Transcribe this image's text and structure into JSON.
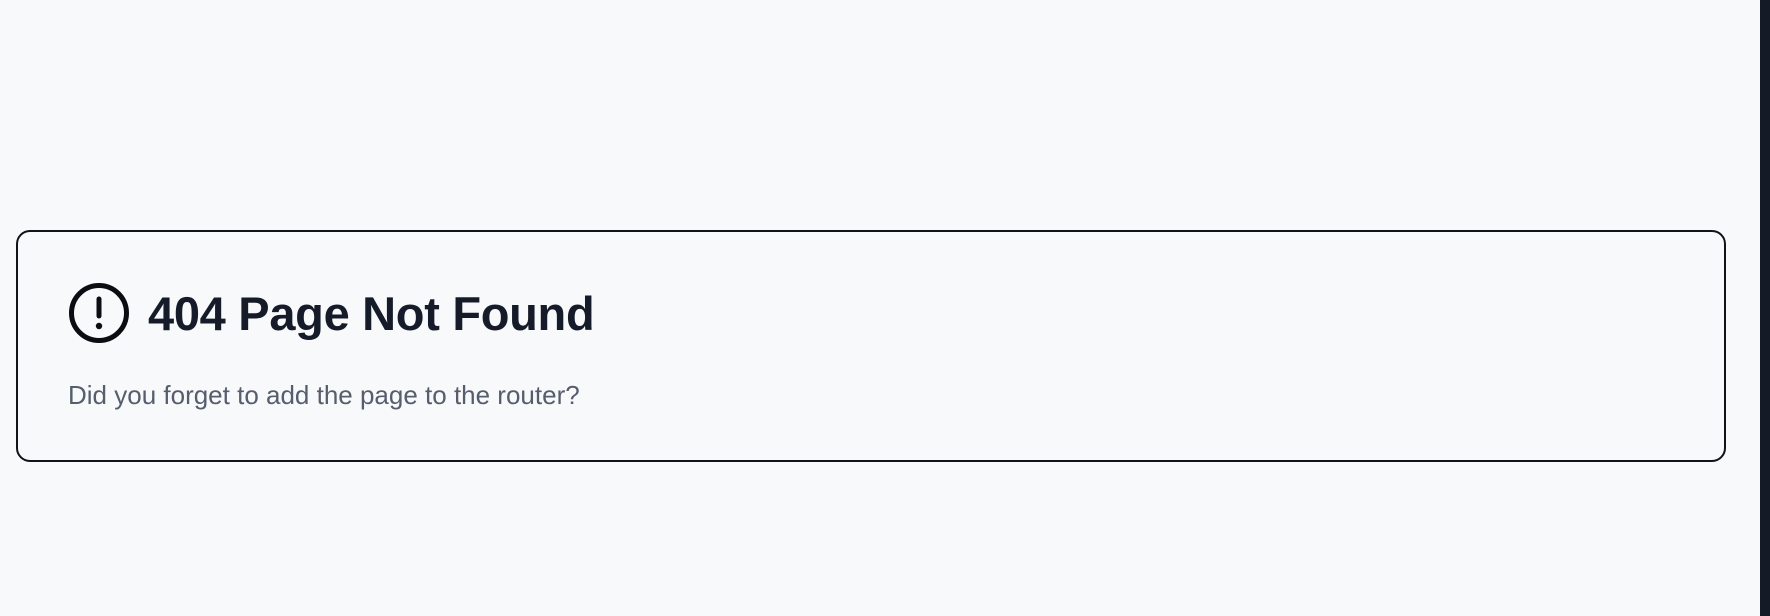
{
  "not_found_card": {
    "icon": "alert-circle-icon",
    "title": "404 Page Not Found",
    "message": "Did you forget to add the page to the router?"
  },
  "colors": {
    "background": "#f8f9fb",
    "card_border": "#111318",
    "title_text": "#161b29",
    "message_text": "#565d6c",
    "edge_bar": "#141a26"
  }
}
